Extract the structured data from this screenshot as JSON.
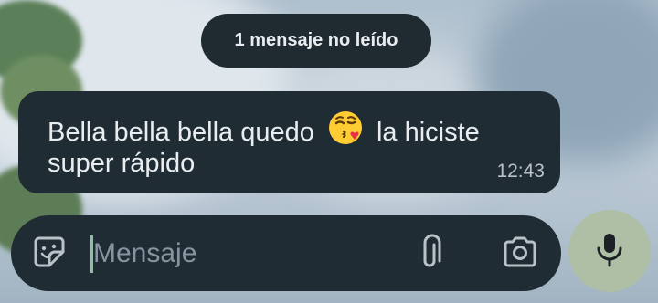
{
  "banner": {
    "unread_text": "1 mensaje no leído"
  },
  "message": {
    "line1_before": "Bella bella bella quedo",
    "line1_after": "la hiciste",
    "line2": "super rápido",
    "emoji": "kissing-face-heart-icon",
    "time": "12:43"
  },
  "composer": {
    "placeholder": "Mensaje",
    "icons": [
      "sticker-icon",
      "paperclip-icon",
      "camera-icon"
    ]
  },
  "mic": {
    "icon": "microphone-icon"
  },
  "colors": {
    "bubble": "#1f2c34",
    "pill": "#1f2a31",
    "mic_button": "#aebfa5",
    "caret": "#8fbf9e"
  }
}
